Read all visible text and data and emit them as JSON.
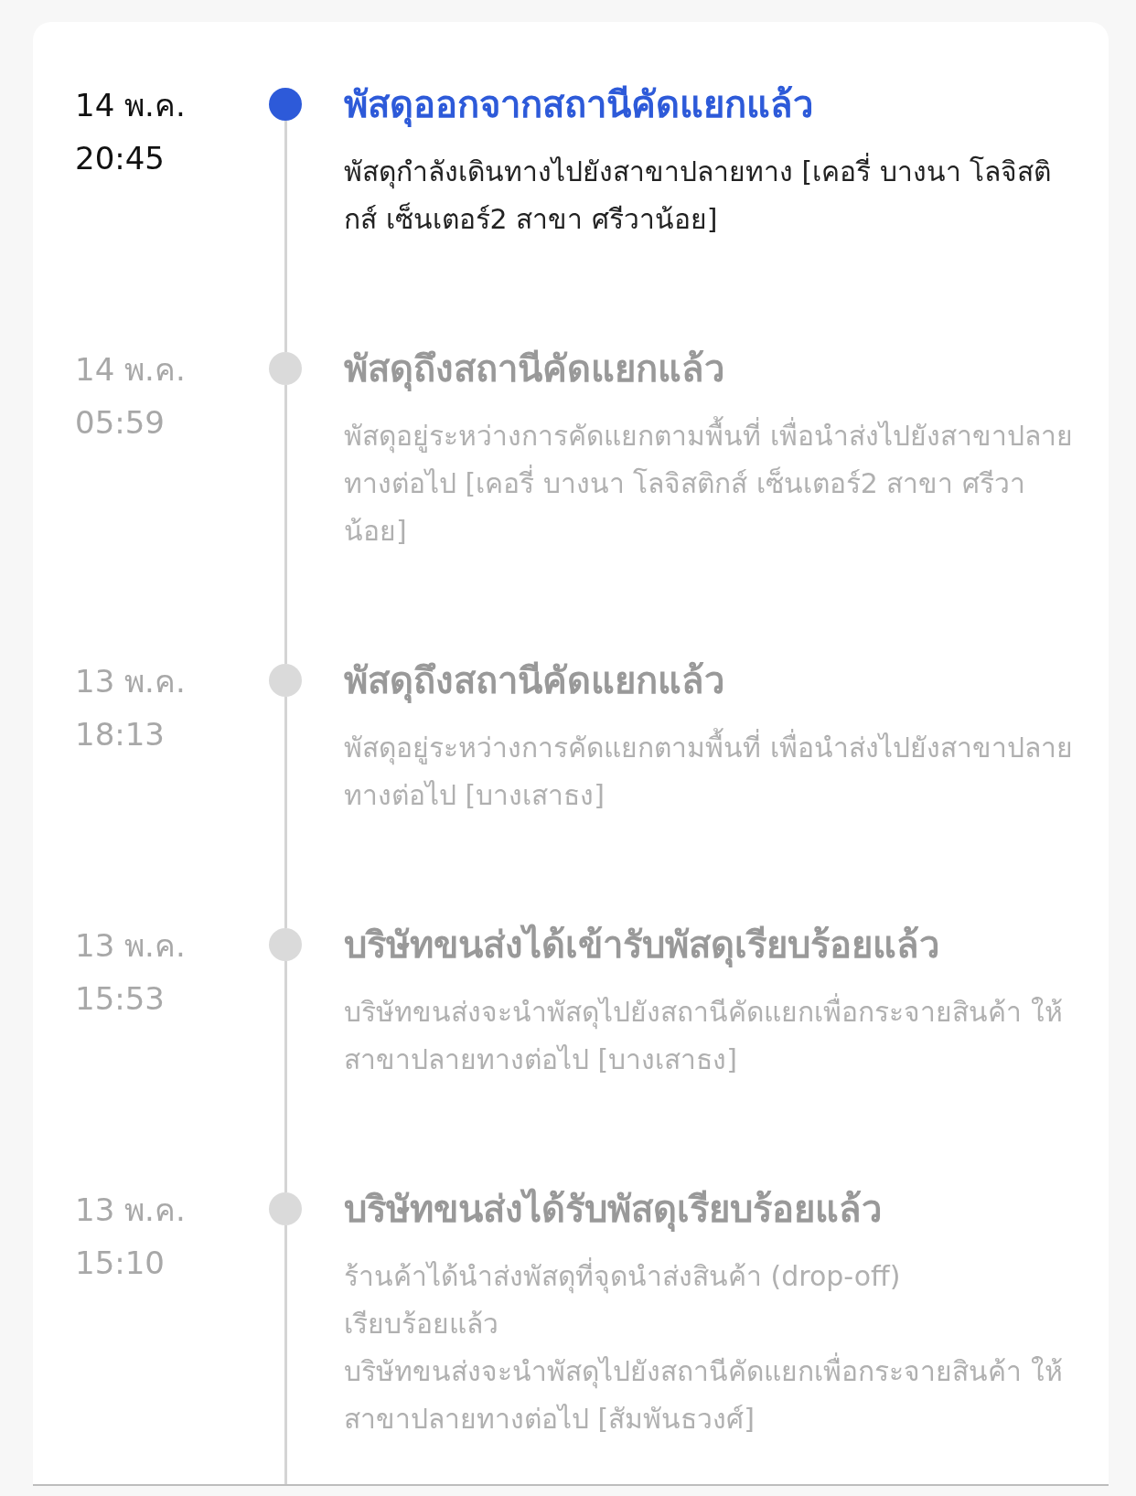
{
  "events": [
    {
      "date": "14 พ.ค.",
      "time": "20:45",
      "title": "พัสดุออกจากสถานีคัดแยกแล้ว",
      "description": "พัสดุกำลังเดินทางไปยังสาขาปลายทาง [เคอรี่ บางนา โลจิสติกส์ เซ็นเตอร์2 สาขา ศรีวาน้อย]",
      "active": true
    },
    {
      "date": "14 พ.ค.",
      "time": "05:59",
      "title": "พัสดุถึงสถานีคัดแยกแล้ว",
      "description": "พัสดุอยู่ระหว่างการคัดแยกตามพื้นที่ เพื่อนำส่งไปยังสาขาปลายทางต่อไป [เคอรี่ บางนา โลจิสติกส์ เซ็นเตอร์2 สาขา ศรีวาน้อย]",
      "active": false
    },
    {
      "date": "13 พ.ค.",
      "time": "18:13",
      "title": "พัสดุถึงสถานีคัดแยกแล้ว",
      "description": "พัสดุอยู่ระหว่างการคัดแยกตามพื้นที่ เพื่อนำส่งไปยังสาขาปลายทางต่อไป [บางเสาธง]",
      "active": false
    },
    {
      "date": "13 พ.ค.",
      "time": "15:53",
      "title": "บริษัทขนส่งได้เข้ารับพัสดุเรียบร้อยแล้ว",
      "description": "บริษัทขนส่งจะนำพัสดุไปยังสถานีคัดแยกเพื่อกระจายสินค้า ให้สาขาปลายทางต่อไป [บางเสาธง]",
      "active": false
    },
    {
      "date": "13 พ.ค.",
      "time": "15:10",
      "title": "บริษัทขนส่งได้รับพัสดุเรียบร้อยแล้ว",
      "description": "ร้านค้าได้นำส่งพัสดุที่จุดนำส่งสินค้า (drop-off)\nเรียบร้อยแล้ว\nบริษัทขนส่งจะนำพัสดุไปยังสถานีคัดแยกเพื่อกระจายสินค้า ให้สาขาปลายทางต่อไป [สัมพันธวงศ์]",
      "active": false
    }
  ]
}
